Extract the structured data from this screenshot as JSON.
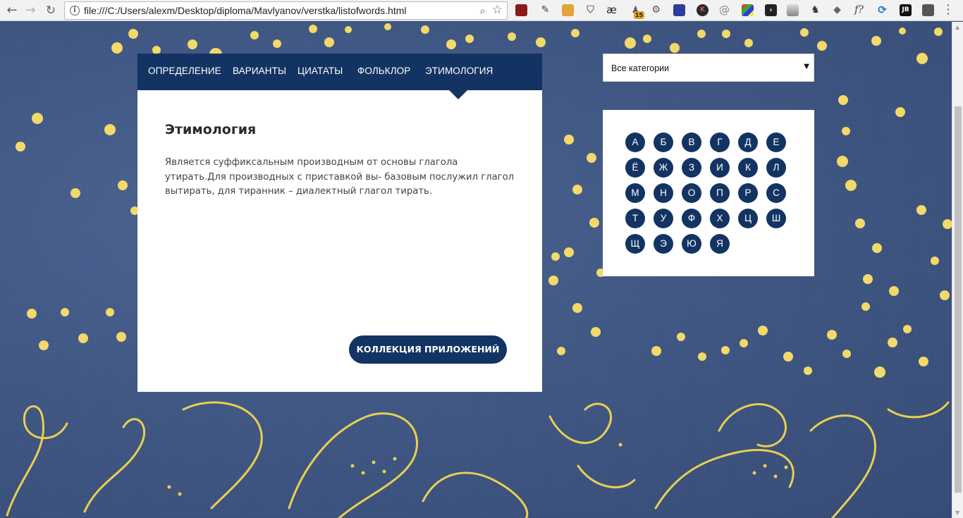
{
  "browser": {
    "url": "file:///C:/Users/alexm/Desktop/diploma/Mavlyanov/verstka/listofwords.html",
    "ext_badge": "15",
    "ext_text_ae": "æ",
    "ext_text_f": "f?",
    "ext_text_jb": "JB"
  },
  "tabs": [
    "ОПРЕДЕЛЕНИЕ",
    "ВАРИАНТЫ",
    "ЦИАТАТЫ",
    "ФОЛЬКЛОР",
    "ЭТИМОЛОГИЯ"
  ],
  "active_tab": "ЭТИМОЛОГИЯ",
  "content": {
    "title": "Этимология",
    "text": "Является суффиксальным производным от основы глагола утирать.Для производных с приставкой вы- базовым послужил глагол вытирать, для тиранник – диалектный глагол тирать."
  },
  "collection_button": "КОЛЛЕКЦИЯ ПРИЛОЖЕНИЙ",
  "category_select": {
    "value": "Все категории"
  },
  "alphabet": [
    "А",
    "Б",
    "В",
    "Г",
    "Д",
    "Е",
    "Ё",
    "Ж",
    "З",
    "И",
    "К",
    "Л",
    "М",
    "Н",
    "О",
    "П",
    "Р",
    "С",
    "Т",
    "У",
    "Ф",
    "Х",
    "Ц",
    "Ш",
    "Щ",
    "Э",
    "Ю",
    "Я"
  ],
  "colors": {
    "primary": "#133463",
    "background": "#3e5683",
    "accent_yellow": "#f2d96a"
  }
}
